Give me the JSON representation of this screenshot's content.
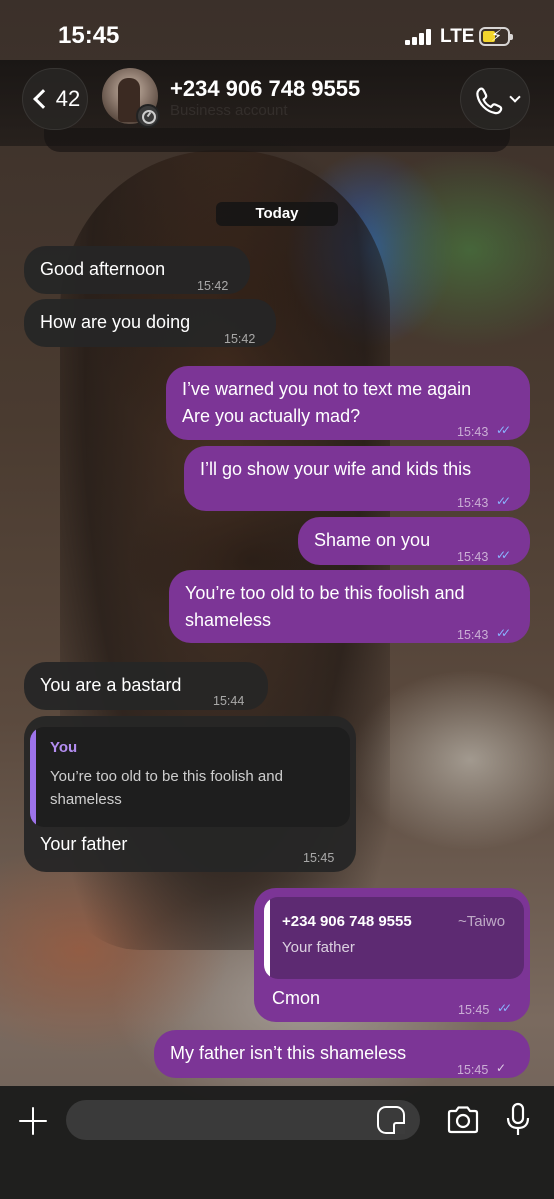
{
  "status_bar": {
    "time": "15:45",
    "network": "LTE"
  },
  "header": {
    "back_count": "42",
    "contact_name": "+234 906 748 9555",
    "contact_subtitle": "Business account"
  },
  "chat": {
    "date_separator": "Today",
    "messages": [
      {
        "direction": "in",
        "lines": [
          "Good afternoon"
        ],
        "time": "15:42"
      },
      {
        "direction": "in",
        "lines": [
          "How are you doing"
        ],
        "time": "15:42"
      },
      {
        "direction": "out",
        "lines": [
          "I’ve warned you not to text me again",
          "Are you actually mad?"
        ],
        "time": "15:43",
        "status": "read"
      },
      {
        "direction": "out",
        "lines": [
          "I’ll go show your wife and kids this"
        ],
        "time": "15:43",
        "status": "read"
      },
      {
        "direction": "out",
        "lines": [
          "Shame on you"
        ],
        "time": "15:43",
        "status": "read"
      },
      {
        "direction": "out",
        "lines": [
          "You’re too old to be this foolish and",
          "shameless"
        ],
        "time": "15:43",
        "status": "read"
      },
      {
        "direction": "in",
        "lines": [
          "You are a bastard"
        ],
        "time": "15:44"
      },
      {
        "direction": "in",
        "reply_to": {
          "author": "You",
          "text": "You’re too old to be this foolish and shameless"
        },
        "lines": [
          "Your father"
        ],
        "time": "15:45"
      },
      {
        "direction": "out",
        "reply_to": {
          "author": "+234 906 748 9555",
          "alias": "~Taiwo",
          "text": "Your father"
        },
        "lines": [
          "Cmon"
        ],
        "time": "15:45",
        "status": "read"
      },
      {
        "direction": "out",
        "lines": [
          "My father isn’t this shameless"
        ],
        "time": "15:45",
        "status": "sent"
      }
    ]
  },
  "composer": {
    "placeholder": ""
  },
  "icons": {
    "back": "chevron-left-icon",
    "call": "phone-icon",
    "add": "plus-icon",
    "sticker": "sticker-icon",
    "camera": "camera-icon",
    "mic": "microphone-icon"
  },
  "colors": {
    "outgoing_bubble": "#7c3596",
    "incoming_bubble": "#262626",
    "read_ticks": "#8ab4ff",
    "quote_author_in": "#b48ef2"
  }
}
